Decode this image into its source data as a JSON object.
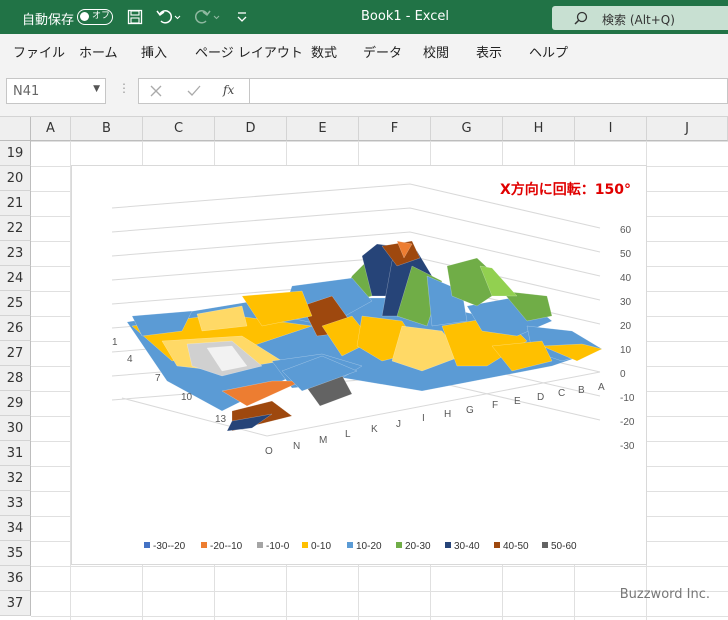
{
  "titlebar": {
    "autosave_label": "自動保存",
    "autosave_state": "オフ",
    "book_title": "Book1  -  Excel",
    "search_label": "検索 (Alt+Q)"
  },
  "menu": [
    "ファイル",
    "ホーム",
    "挿入",
    "ページ レイアウト",
    "数式",
    "データ",
    "校閲",
    "表示",
    "ヘルプ"
  ],
  "namebox": "N41",
  "fx_label": "fx",
  "columns": [
    "A",
    "B",
    "C",
    "D",
    "E",
    "F",
    "G",
    "H",
    "I",
    "J"
  ],
  "rows": [
    "19",
    "20",
    "21",
    "22",
    "23",
    "24",
    "25",
    "26",
    "27",
    "28",
    "29",
    "30",
    "31",
    "32",
    "33",
    "34",
    "35",
    "36",
    "37"
  ],
  "annotation": "X方向に回転：150°",
  "watermark": "Buzzword Inc.",
  "chart_data": {
    "type": "surface",
    "z_ticks": [
      "60",
      "50",
      "40",
      "30",
      "20",
      "10",
      "0",
      "-10",
      "-20",
      "-30"
    ],
    "x_ticks": [
      "O",
      "N",
      "M",
      "L",
      "K",
      "J",
      "I",
      "H",
      "G",
      "F",
      "E",
      "D",
      "C",
      "B",
      "A"
    ],
    "y_ticks": [
      "1",
      "4",
      "7",
      "10",
      "13"
    ],
    "legend": [
      "-30--20",
      "-20--10",
      "-10-0",
      "0-10",
      "10-20",
      "20-30",
      "30-40",
      "40-50",
      "50-60"
    ],
    "legend_colors": [
      "#4472c4",
      "#ed7d31",
      "#a5a5a5",
      "#ffc000",
      "#5b9bd5",
      "#70ad47",
      "#264478",
      "#9e480e",
      "#636363"
    ]
  }
}
